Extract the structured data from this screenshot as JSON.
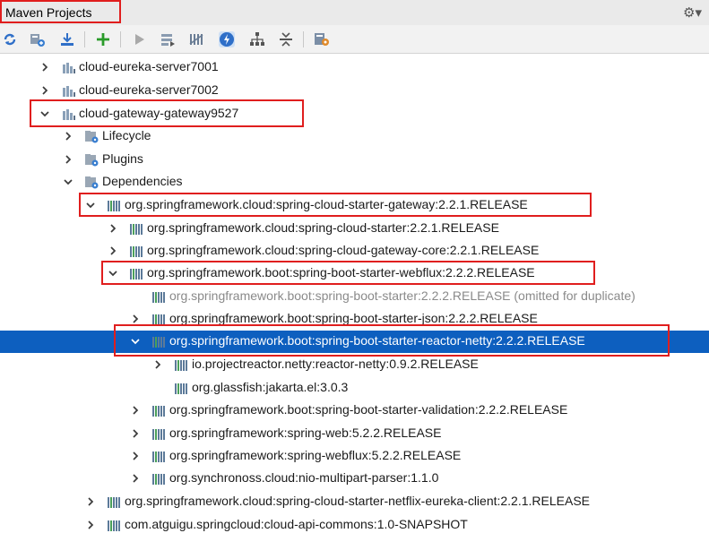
{
  "panel": {
    "title": "Maven Projects"
  },
  "toolbar": {
    "icons": [
      "reimport-icon",
      "generate-sources-icon",
      "download-icon",
      "add-icon",
      "run-icon",
      "execute-goal-icon",
      "toggle-offline-icon",
      "skip-tests-icon",
      "show-dependencies-icon",
      "collapse-all-icon",
      "settings-icon"
    ]
  },
  "tree": {
    "rows": [
      {
        "label": "cloud-eureka-server7001",
        "icon": "module",
        "expanded": false
      },
      {
        "label": "cloud-eureka-server7002",
        "icon": "module",
        "expanded": false
      },
      {
        "label": "cloud-gateway-gateway9527",
        "icon": "module",
        "expanded": true
      },
      {
        "label": "Lifecycle",
        "icon": "folder",
        "expanded": false
      },
      {
        "label": "Plugins",
        "icon": "folder",
        "expanded": false
      },
      {
        "label": "Dependencies",
        "icon": "folder",
        "expanded": true
      },
      {
        "label": "org.springframework.cloud:spring-cloud-starter-gateway:2.2.1.RELEASE",
        "icon": "lib",
        "expanded": true
      },
      {
        "label": "org.springframework.cloud:spring-cloud-starter:2.2.1.RELEASE",
        "icon": "lib",
        "expanded": false
      },
      {
        "label": "org.springframework.cloud:spring-cloud-gateway-core:2.2.1.RELEASE",
        "icon": "lib",
        "expanded": false
      },
      {
        "label": "org.springframework.boot:spring-boot-starter-webflux:2.2.2.RELEASE",
        "icon": "lib",
        "expanded": true
      },
      {
        "label": "org.springframework.boot:spring-boot-starter:2.2.2.RELEASE (omitted for duplicate)",
        "icon": "lib",
        "expanded": null
      },
      {
        "label": "org.springframework.boot:spring-boot-starter-json:2.2.2.RELEASE",
        "icon": "lib",
        "expanded": false
      },
      {
        "label": "org.springframework.boot:spring-boot-starter-reactor-netty:2.2.2.RELEASE",
        "icon": "lib",
        "expanded": true,
        "selected": true
      },
      {
        "label": "io.projectreactor.netty:reactor-netty:0.9.2.RELEASE",
        "icon": "lib",
        "expanded": false
      },
      {
        "label": "org.glassfish:jakarta.el:3.0.3",
        "icon": "lib",
        "expanded": null
      },
      {
        "label": "org.springframework.boot:spring-boot-starter-validation:2.2.2.RELEASE",
        "icon": "lib",
        "expanded": false
      },
      {
        "label": "org.springframework:spring-web:5.2.2.RELEASE",
        "icon": "lib",
        "expanded": false
      },
      {
        "label": "org.springframework:spring-webflux:5.2.2.RELEASE",
        "icon": "lib",
        "expanded": false
      },
      {
        "label": "org.synchronoss.cloud:nio-multipart-parser:1.1.0",
        "icon": "lib",
        "expanded": false
      },
      {
        "label": "org.springframework.cloud:spring-cloud-starter-netflix-eureka-client:2.2.1.RELEASE",
        "icon": "lib",
        "expanded": false
      },
      {
        "label": "com.atguigu.springcloud:cloud-api-commons:1.0-SNAPSHOT",
        "icon": "lib",
        "expanded": false
      }
    ]
  },
  "colors": {
    "selection": "#0d5fbf",
    "highlight_box": "#e01e1e"
  }
}
